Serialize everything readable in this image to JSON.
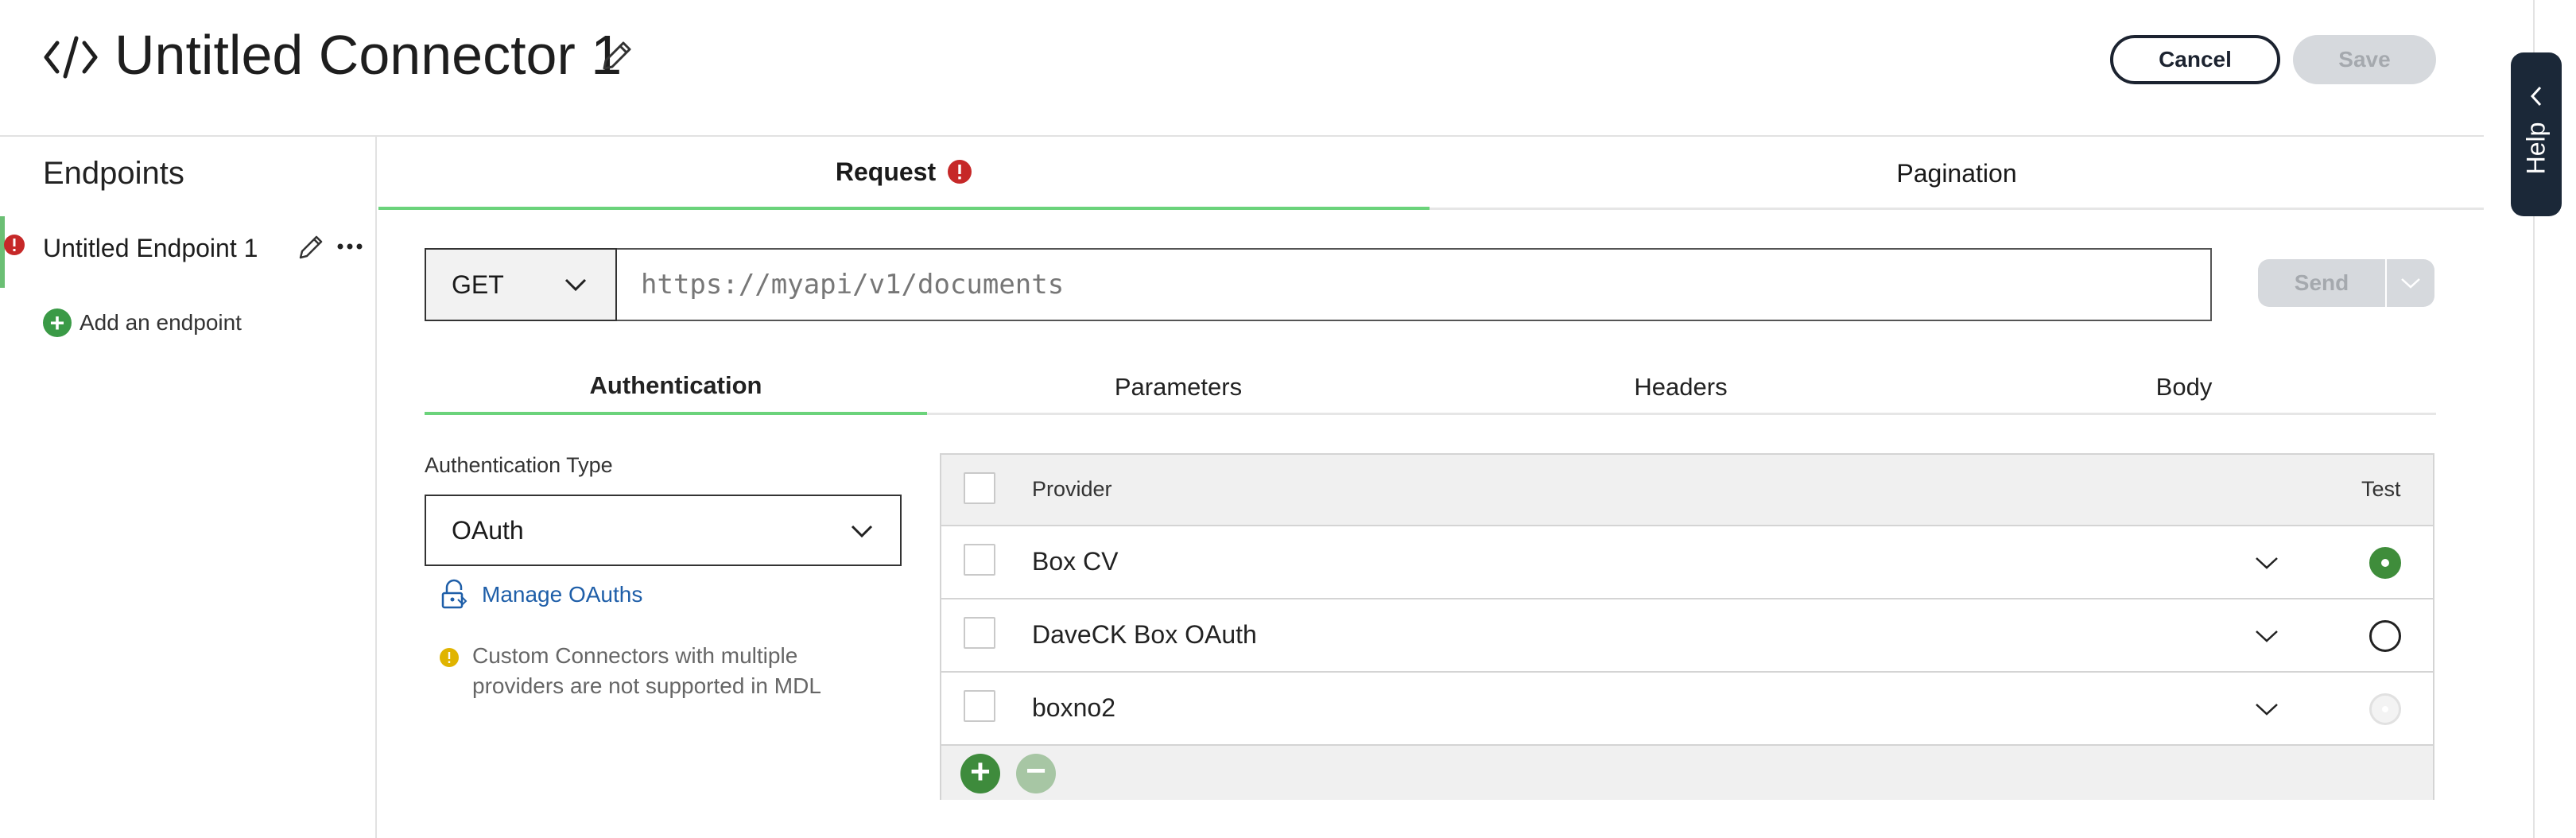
{
  "header": {
    "title": "Untitled Connector 1",
    "cancel_label": "Cancel",
    "save_label": "Save"
  },
  "help": {
    "label": "Help"
  },
  "sidebar": {
    "title": "Endpoints",
    "endpoints": [
      {
        "label": "Untitled Endpoint 1",
        "has_error": true
      }
    ],
    "add_label": "Add an endpoint"
  },
  "main_tabs": [
    {
      "label": "Request",
      "active": true,
      "has_error": true
    },
    {
      "label": "Pagination",
      "active": false
    }
  ],
  "request": {
    "method": "GET",
    "url_placeholder": "https://myapi/v1/documents",
    "send_label": "Send"
  },
  "sub_tabs": [
    {
      "label": "Authentication",
      "active": true
    },
    {
      "label": "Parameters",
      "active": false
    },
    {
      "label": "Headers",
      "active": false
    },
    {
      "label": "Body",
      "active": false
    }
  ],
  "auth": {
    "type_label": "Authentication Type",
    "type_value": "OAuth",
    "manage_label": "Manage OAuths",
    "warning": "Custom Connectors with multiple providers are not supported in MDL"
  },
  "providers": {
    "headers": {
      "provider": "Provider",
      "test": "Test"
    },
    "rows": [
      {
        "name": "Box CV",
        "test": "selected"
      },
      {
        "name": "DaveCK Box OAuth",
        "test": "unselected"
      },
      {
        "name": "boxno2",
        "test": "disabled"
      }
    ]
  },
  "colors": {
    "accent_green": "#6bd37b",
    "primary_green": "#3e8b3c",
    "error_red": "#c62828",
    "warning_yellow": "#e0b400",
    "link_blue": "#1e5ea8",
    "dark_navy": "#1b2838"
  }
}
